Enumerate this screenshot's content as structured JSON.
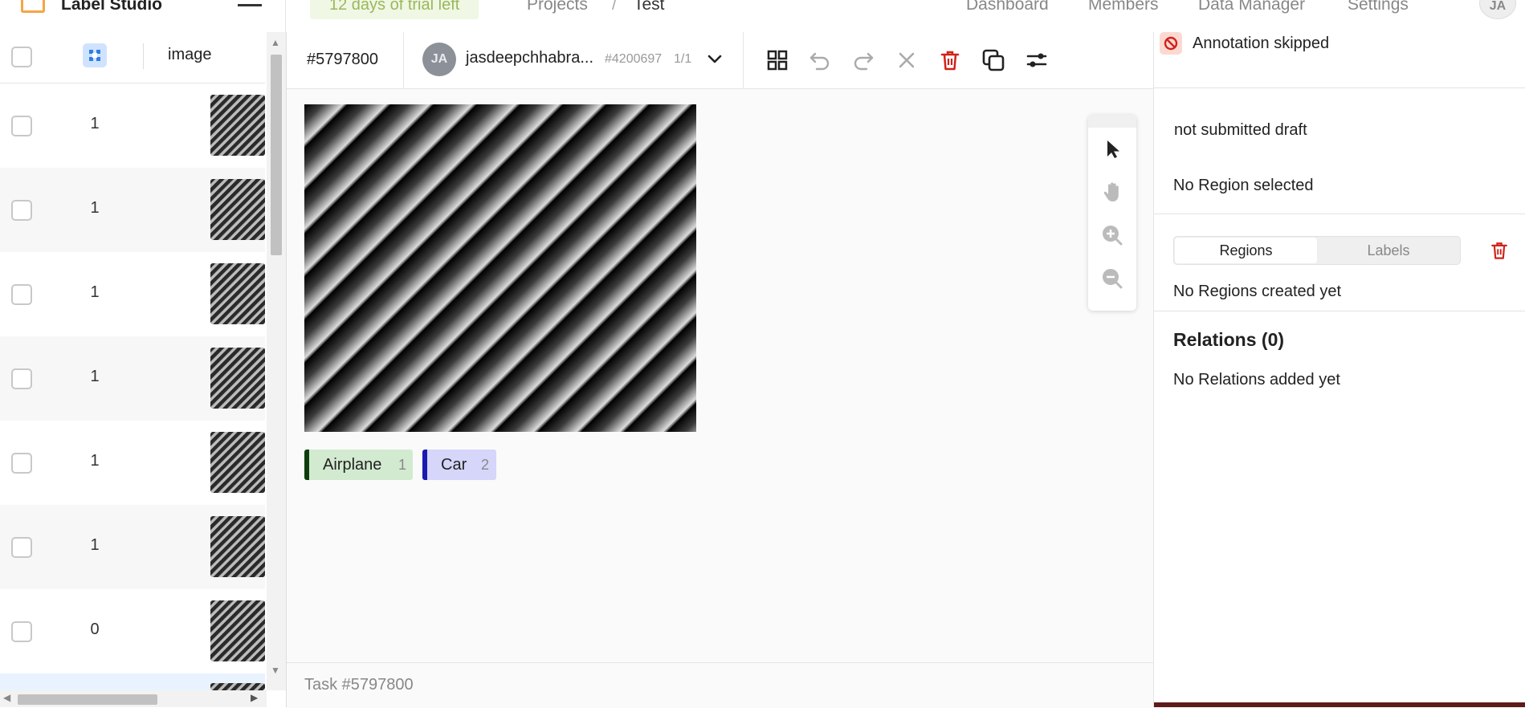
{
  "app": {
    "name": "Label Studio"
  },
  "header": {
    "trial_badge": "12 days of trial left",
    "breadcrumb": {
      "projects": "Projects",
      "separator": "/",
      "current": "Test"
    },
    "nav": [
      "Dashboard",
      "Members",
      "Data Manager",
      "Settings"
    ],
    "avatar_initials": "JA"
  },
  "table": {
    "column_header": "image",
    "rows": [
      {
        "count": "1"
      },
      {
        "count": "1"
      },
      {
        "count": "1"
      },
      {
        "count": "1"
      },
      {
        "count": "1"
      },
      {
        "count": "1"
      },
      {
        "count": "0"
      }
    ]
  },
  "toolbar": {
    "task_id": "#5797800",
    "user": {
      "initials": "JA",
      "name": "jasdeepchhabra...",
      "annotation_id": "#4200697",
      "annotation_count": "1/1"
    },
    "icons": [
      "grid-icon",
      "undo-icon",
      "redo-icon",
      "reset-icon",
      "delete-icon",
      "copy-icon",
      "settings-toggle-icon"
    ]
  },
  "canvas": {
    "tools": [
      "pointer-icon",
      "hand-icon",
      "zoom-in-icon",
      "zoom-out-icon"
    ]
  },
  "labels": [
    {
      "name": "Airplane",
      "hotkey": "1",
      "color": "#0d3d0d",
      "bg": "#d2ead0"
    },
    {
      "name": "Car",
      "hotkey": "2",
      "color": "#1a1ab0",
      "bg": "#d6d6fb"
    }
  ],
  "footer": {
    "task": "Task #5797800"
  },
  "sidebar": {
    "status": "Annotation skipped",
    "draft": "not submitted draft",
    "no_region": "No Region selected",
    "tabs": {
      "regions": "Regions",
      "labels": "Labels"
    },
    "no_regions": "No Regions created yet",
    "relations_title": "Relations (0)",
    "no_relations": "No Relations added yet"
  },
  "colors": {
    "accent": "#f5a545",
    "danger": "#d0221a",
    "trial_text": "#9ab85a"
  }
}
